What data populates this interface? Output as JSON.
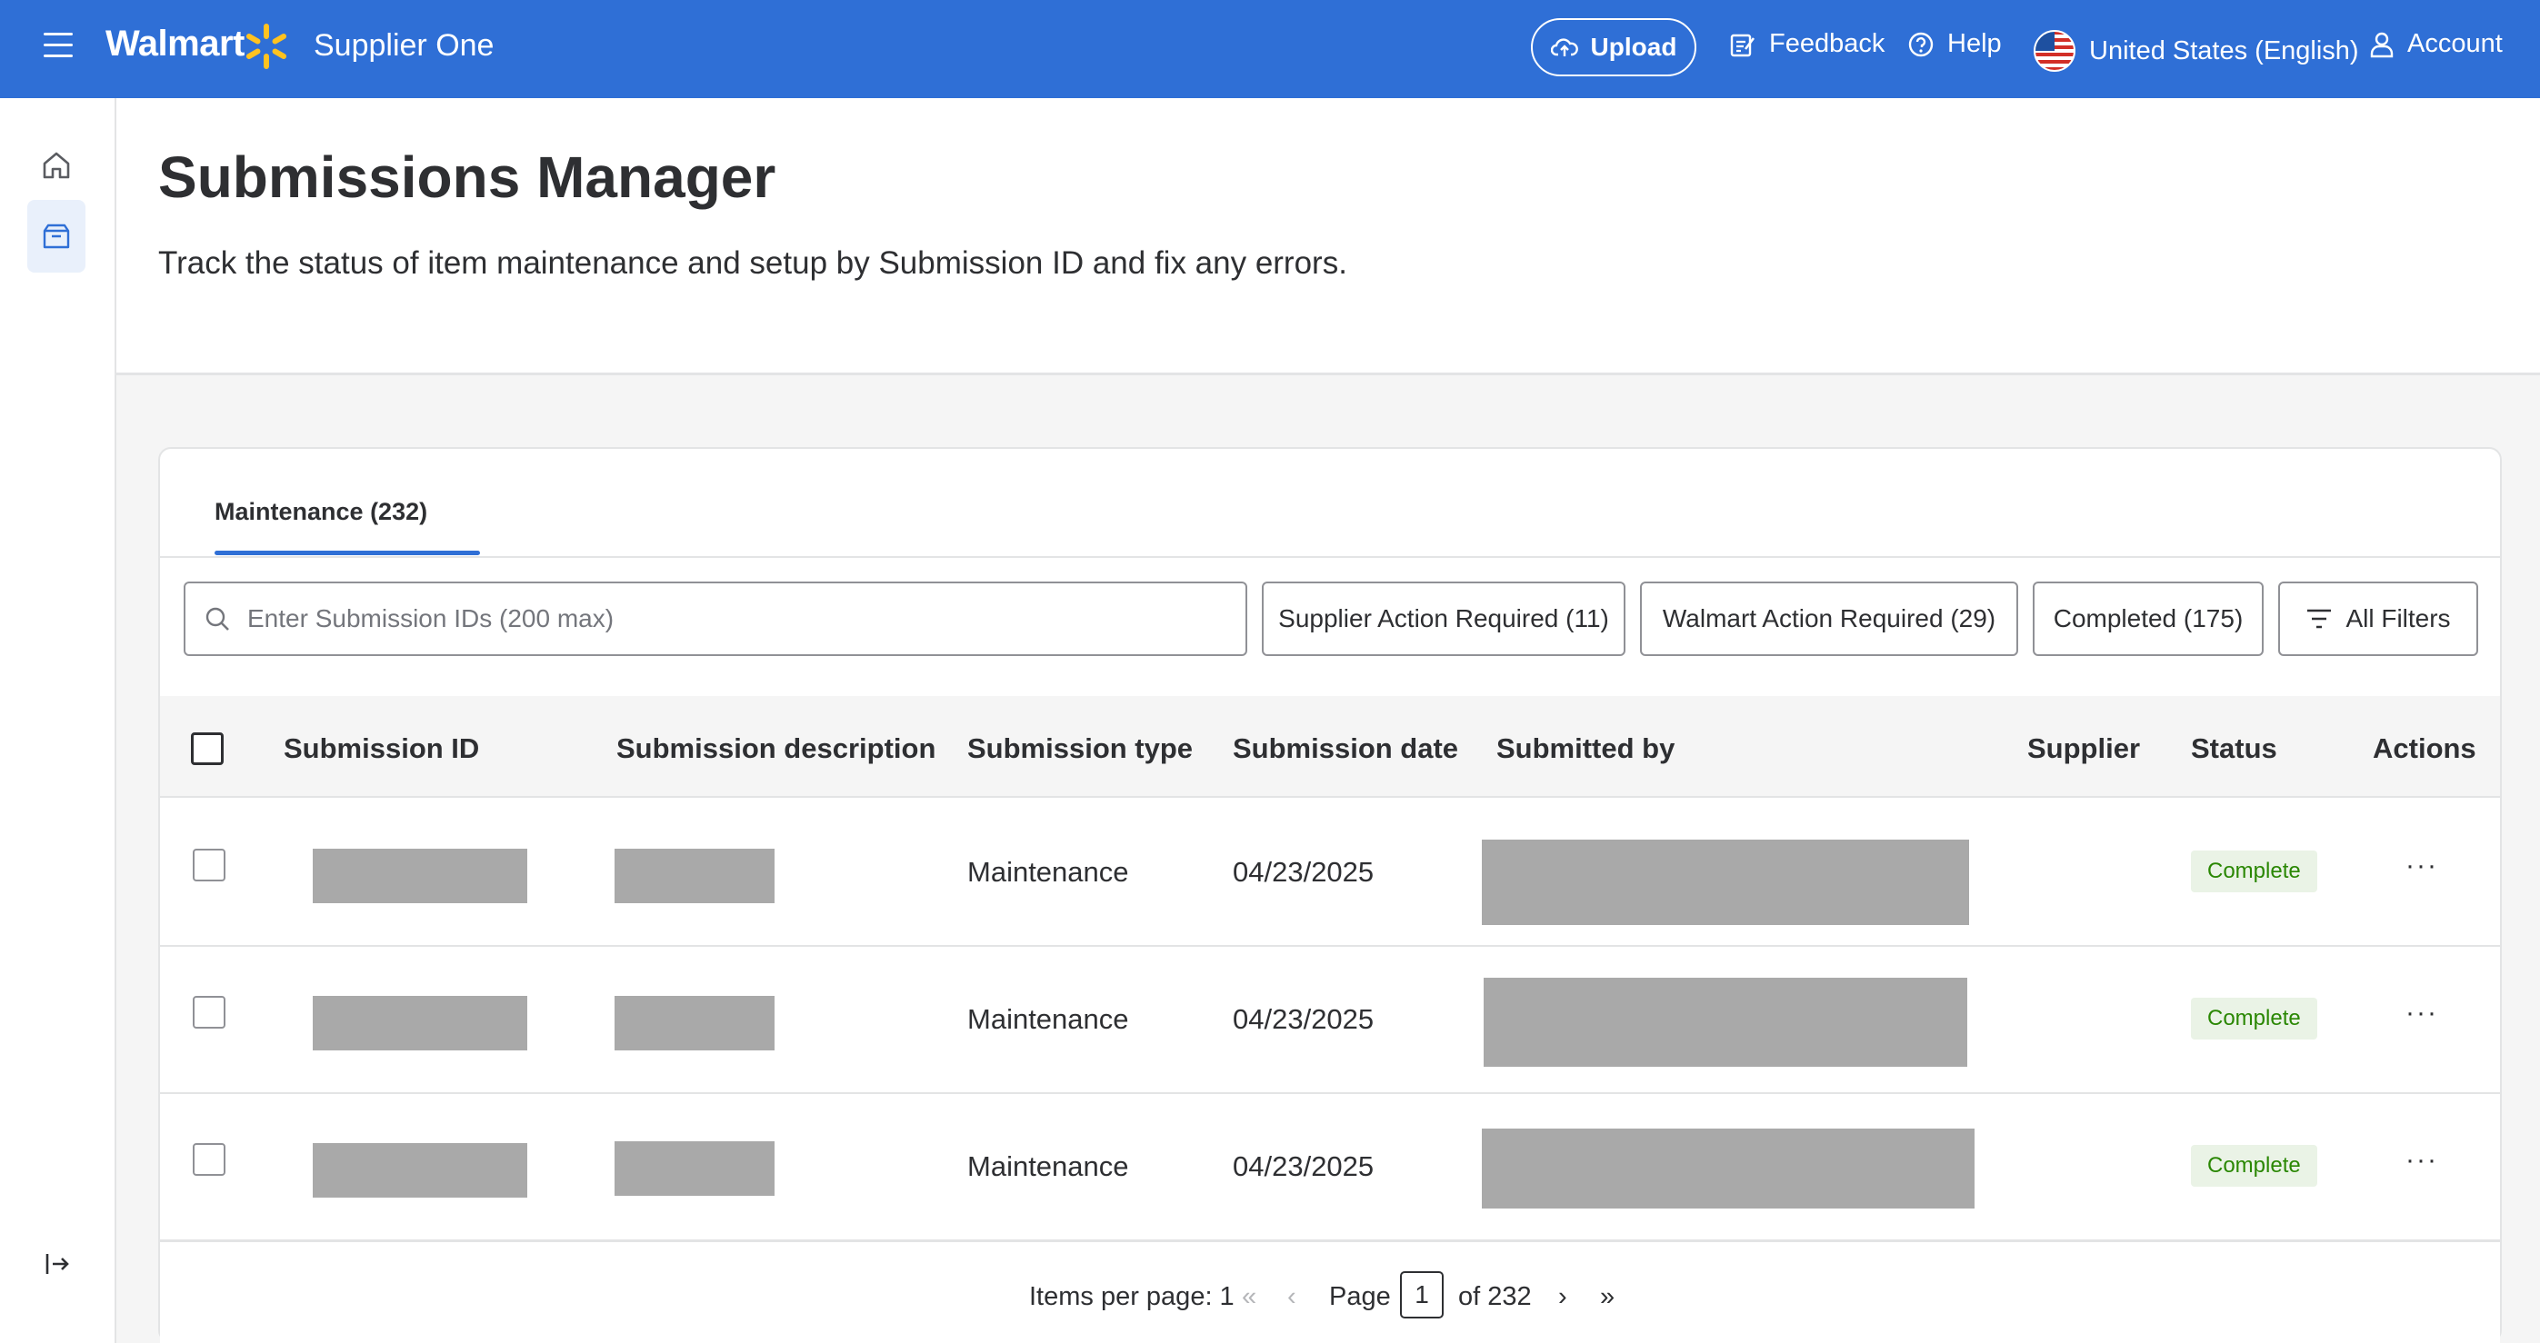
{
  "header": {
    "brand": "Walmart",
    "product": "Supplier One",
    "upload_label": "Upload",
    "feedback_label": "Feedback",
    "help_label": "Help",
    "locale_label": "United States (English)",
    "account_label": "Account",
    "bg_color": "#2f6fd6",
    "spark_color": "#ffc220"
  },
  "sidebar": {
    "items": [
      {
        "icon": "home-icon"
      },
      {
        "icon": "box-icon",
        "active": true
      }
    ],
    "collapse_icon": "collapse-icon"
  },
  "page": {
    "title": "Submissions Manager",
    "description": "Track the status of item maintenance and setup by Submission ID and fix any errors."
  },
  "tabs": [
    {
      "label": "Maintenance",
      "count": "(232)",
      "active": true
    }
  ],
  "search": {
    "placeholder": "Enter Submission IDs (200 max)"
  },
  "filters": {
    "supplier_action": "Supplier Action Required (11)",
    "walmart_action": "Walmart Action Required (29)",
    "completed": "Completed (175)",
    "all_filters": "All Filters"
  },
  "table": {
    "columns": {
      "id": "Submission ID",
      "description": "Submission description",
      "type": "Submission type",
      "date": "Submission date",
      "submitted_by": "Submitted by",
      "supplier": "Supplier",
      "status": "Status",
      "actions": "Actions"
    },
    "rows": [
      {
        "type": "Maintenance",
        "date": "04/23/2025",
        "status": "Complete",
        "actions": "···"
      },
      {
        "type": "Maintenance",
        "date": "04/23/2025",
        "status": "Complete",
        "actions": "···"
      },
      {
        "type": "Maintenance",
        "date": "04/23/2025",
        "status": "Complete",
        "actions": "···"
      }
    ]
  },
  "pagination": {
    "items_per_page": "Items per page: 1",
    "page_label": "Page",
    "current_page": "1",
    "of_total": "of 232"
  }
}
